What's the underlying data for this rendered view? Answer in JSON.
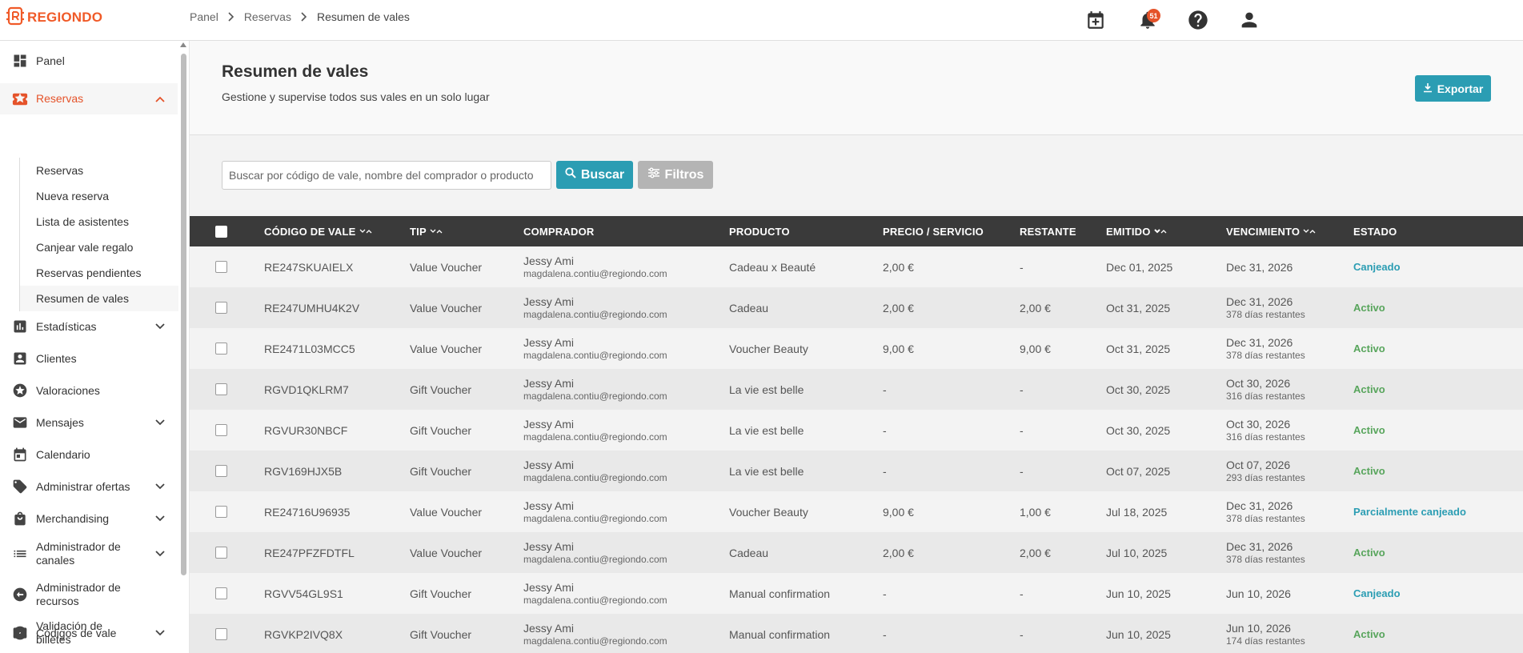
{
  "app": {
    "logo_text": "REGIONDO",
    "brand_color": "#f05a28",
    "accent_color": "#2b9db3",
    "notification_count": "51"
  },
  "breadcrumb": [
    "Panel",
    "Reservas",
    "Resumen de vales"
  ],
  "sidebar": {
    "items": [
      {
        "label": "Panel",
        "icon": "dashboard-icon"
      },
      {
        "label": "Reservas",
        "icon": "star-ticket-icon",
        "expanded": true
      },
      {
        "label": "Estadísticas",
        "icon": "bar-chart-icon"
      },
      {
        "label": "Clientes",
        "icon": "person-icon"
      },
      {
        "label": "Valoraciones",
        "icon": "star-circle-icon"
      },
      {
        "label": "Mensajes",
        "icon": "mail-icon"
      },
      {
        "label": "Calendario",
        "icon": "calendar-icon"
      },
      {
        "label": "Administrar ofertas",
        "icon": "tag-icon"
      },
      {
        "label": "Merchandising",
        "icon": "shopping-bag-icon"
      },
      {
        "label": "Administrador de canales",
        "line1": "Administrador de",
        "line2": "canales",
        "icon": "channels-icon"
      },
      {
        "label": "Administrador de recursos",
        "line1": "Administrador de",
        "line2": "recursos",
        "icon": "resources-icon"
      },
      {
        "label": "Códigos de vale",
        "icon": "percent-icon"
      },
      {
        "label": "Validación de billetes",
        "line1": "Validación de",
        "line2": "billetes",
        "icon": "ticket-icon"
      }
    ],
    "reservas_sub": [
      "Reservas",
      "Nueva reserva",
      "Lista de asistentes",
      "Canjear vale regalo",
      "Reservas pendientes",
      "Resumen de vales"
    ]
  },
  "page": {
    "title": "Resumen de vales",
    "subtitle": "Gestione y supervise todos sus vales en un solo lugar",
    "export_label": "Exportar"
  },
  "search": {
    "placeholder": "Buscar por código de vale, nombre del comprador o producto",
    "search_label": "Buscar",
    "filter_label": "Filtros"
  },
  "table": {
    "columns": [
      "CÓDIGO DE VALE",
      "TIP",
      "COMPRADOR",
      "PRODUCTO",
      "PRECIO / SERVICIO",
      "RESTANTE",
      "EMITIDO",
      "VENCIMIENTO",
      "ESTADO"
    ],
    "rows": [
      {
        "code": "RE247SKUAIELX",
        "type": "Value Voucher",
        "buyer": "Jessy Ami",
        "email": "magdalena.contiu@regiondo.com",
        "product": "Cadeau x Beauté",
        "price": "2,00 €",
        "remaining": "-",
        "issued": "Dec 01, 2025",
        "expiry": "Dec 31, 2026",
        "expiry_note": "",
        "status": "Canjeado",
        "status_kind": "redeemed"
      },
      {
        "code": "RE247UMHU4K2V",
        "type": "Value Voucher",
        "buyer": "Jessy Ami",
        "email": "magdalena.contiu@regiondo.com",
        "product": "Cadeau",
        "price": "2,00 €",
        "remaining": "2,00 €",
        "issued": "Oct 31, 2025",
        "expiry": "Dec 31, 2026",
        "expiry_note": "378 días restantes",
        "status": "Activo",
        "status_kind": "active"
      },
      {
        "code": "RE2471L03MCC5",
        "type": "Value Voucher",
        "buyer": "Jessy Ami",
        "email": "magdalena.contiu@regiondo.com",
        "product": "Voucher Beauty",
        "price": "9,00 €",
        "remaining": "9,00 €",
        "issued": "Oct 31, 2025",
        "expiry": "Dec 31, 2026",
        "expiry_note": "378 días restantes",
        "status": "Activo",
        "status_kind": "active"
      },
      {
        "code": "RGVD1QKLRM7",
        "type": "Gift Voucher",
        "buyer": "Jessy Ami",
        "email": "magdalena.contiu@regiondo.com",
        "product": "La vie est belle",
        "price": "-",
        "remaining": "-",
        "issued": "Oct 30, 2025",
        "expiry": "Oct 30, 2026",
        "expiry_note": "316 días restantes",
        "status": "Activo",
        "status_kind": "active"
      },
      {
        "code": "RGVUR30NBCF",
        "type": "Gift Voucher",
        "buyer": "Jessy Ami",
        "email": "magdalena.contiu@regiondo.com",
        "product": "La vie est belle",
        "price": "-",
        "remaining": "-",
        "issued": "Oct 30, 2025",
        "expiry": "Oct 30, 2026",
        "expiry_note": "316 días restantes",
        "status": "Activo",
        "status_kind": "active"
      },
      {
        "code": "RGV169HJX5B",
        "type": "Gift Voucher",
        "buyer": "Jessy Ami",
        "email": "magdalena.contiu@regiondo.com",
        "product": "La vie est belle",
        "price": "-",
        "remaining": "-",
        "issued": "Oct 07, 2025",
        "expiry": "Oct 07, 2026",
        "expiry_note": "293 días restantes",
        "status": "Activo",
        "status_kind": "active"
      },
      {
        "code": "RE24716U96935",
        "type": "Value Voucher",
        "buyer": "Jessy Ami",
        "email": "magdalena.contiu@regiondo.com",
        "product": "Voucher Beauty",
        "price": "9,00 €",
        "remaining": "1,00 €",
        "issued": "Jul 18, 2025",
        "expiry": "Dec 31, 2026",
        "expiry_note": "378 días restantes",
        "status": "Parcialmente canjeado",
        "status_kind": "partial"
      },
      {
        "code": "RE247PFZFDTFL",
        "type": "Value Voucher",
        "buyer": "Jessy Ami",
        "email": "magdalena.contiu@regiondo.com",
        "product": "Cadeau",
        "price": "2,00 €",
        "remaining": "2,00 €",
        "issued": "Jul 10, 2025",
        "expiry": "Dec 31, 2026",
        "expiry_note": "378 días restantes",
        "status": "Activo",
        "status_kind": "active"
      },
      {
        "code": "RGVV54GL9S1",
        "type": "Gift Voucher",
        "buyer": "Jessy Ami",
        "email": "magdalena.contiu@regiondo.com",
        "product": "Manual confirmation",
        "price": "-",
        "remaining": "-",
        "issued": "Jun 10, 2025",
        "expiry": "Jun 10, 2026",
        "expiry_note": "",
        "status": "Canjeado",
        "status_kind": "redeemed"
      },
      {
        "code": "RGVKP2IVQ8X",
        "type": "Gift Voucher",
        "buyer": "Jessy Ami",
        "email": "magdalena.contiu@regiondo.com",
        "product": "Manual confirmation",
        "price": "-",
        "remaining": "-",
        "issued": "Jun 10, 2025",
        "expiry": "Jun 10, 2026",
        "expiry_note": "174 días restantes",
        "status": "Activo",
        "status_kind": "active"
      }
    ]
  }
}
